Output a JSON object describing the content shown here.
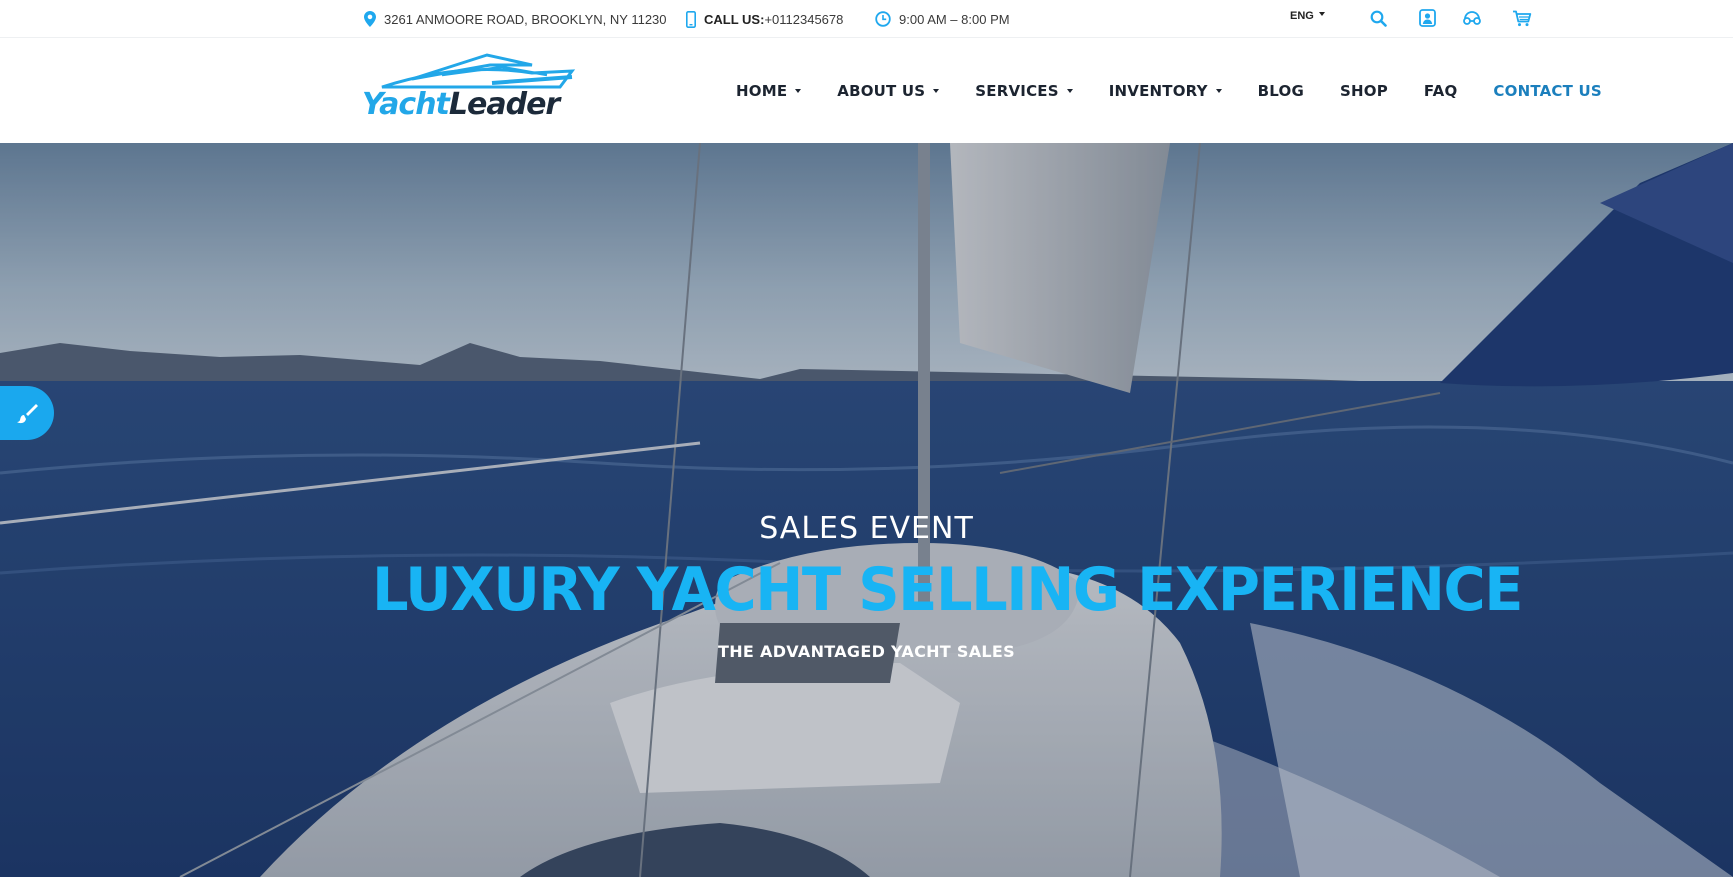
{
  "topbar": {
    "address": "3261 ANMOORE ROAD, BROOKLYN, NY 11230",
    "phone_label": "CALL US:",
    "phone_number": "+0112345678",
    "hours": "9:00 AM – 8:00 PM",
    "language": "ENG",
    "icons": [
      "map-pin-icon",
      "mobile-phone-icon",
      "clock-icon",
      "search-icon",
      "user-icon",
      "compare-icon",
      "cart-icon"
    ]
  },
  "logo": {
    "part1": "Yacht",
    "part2": "Leader"
  },
  "nav": {
    "items": [
      {
        "label": "HOME",
        "dropdown": true
      },
      {
        "label": "ABOUT US",
        "dropdown": true
      },
      {
        "label": "SERVICES",
        "dropdown": true
      },
      {
        "label": "INVENTORY",
        "dropdown": true
      },
      {
        "label": "BLOG",
        "dropdown": false
      },
      {
        "label": "SHOP",
        "dropdown": false
      },
      {
        "label": "FAQ",
        "dropdown": false
      },
      {
        "label": "CONTACT US",
        "dropdown": false,
        "active": true
      }
    ]
  },
  "hero": {
    "kicker": "SALES EVENT",
    "title": "LUXURY YACHT SELLING EXPERIENCE",
    "subtitle": "THE ADVANTAGED YACHT SALES"
  },
  "colors": {
    "accent": "#18b4f4",
    "nav_active": "#1b7fbd",
    "text_dark": "#1c2430"
  }
}
